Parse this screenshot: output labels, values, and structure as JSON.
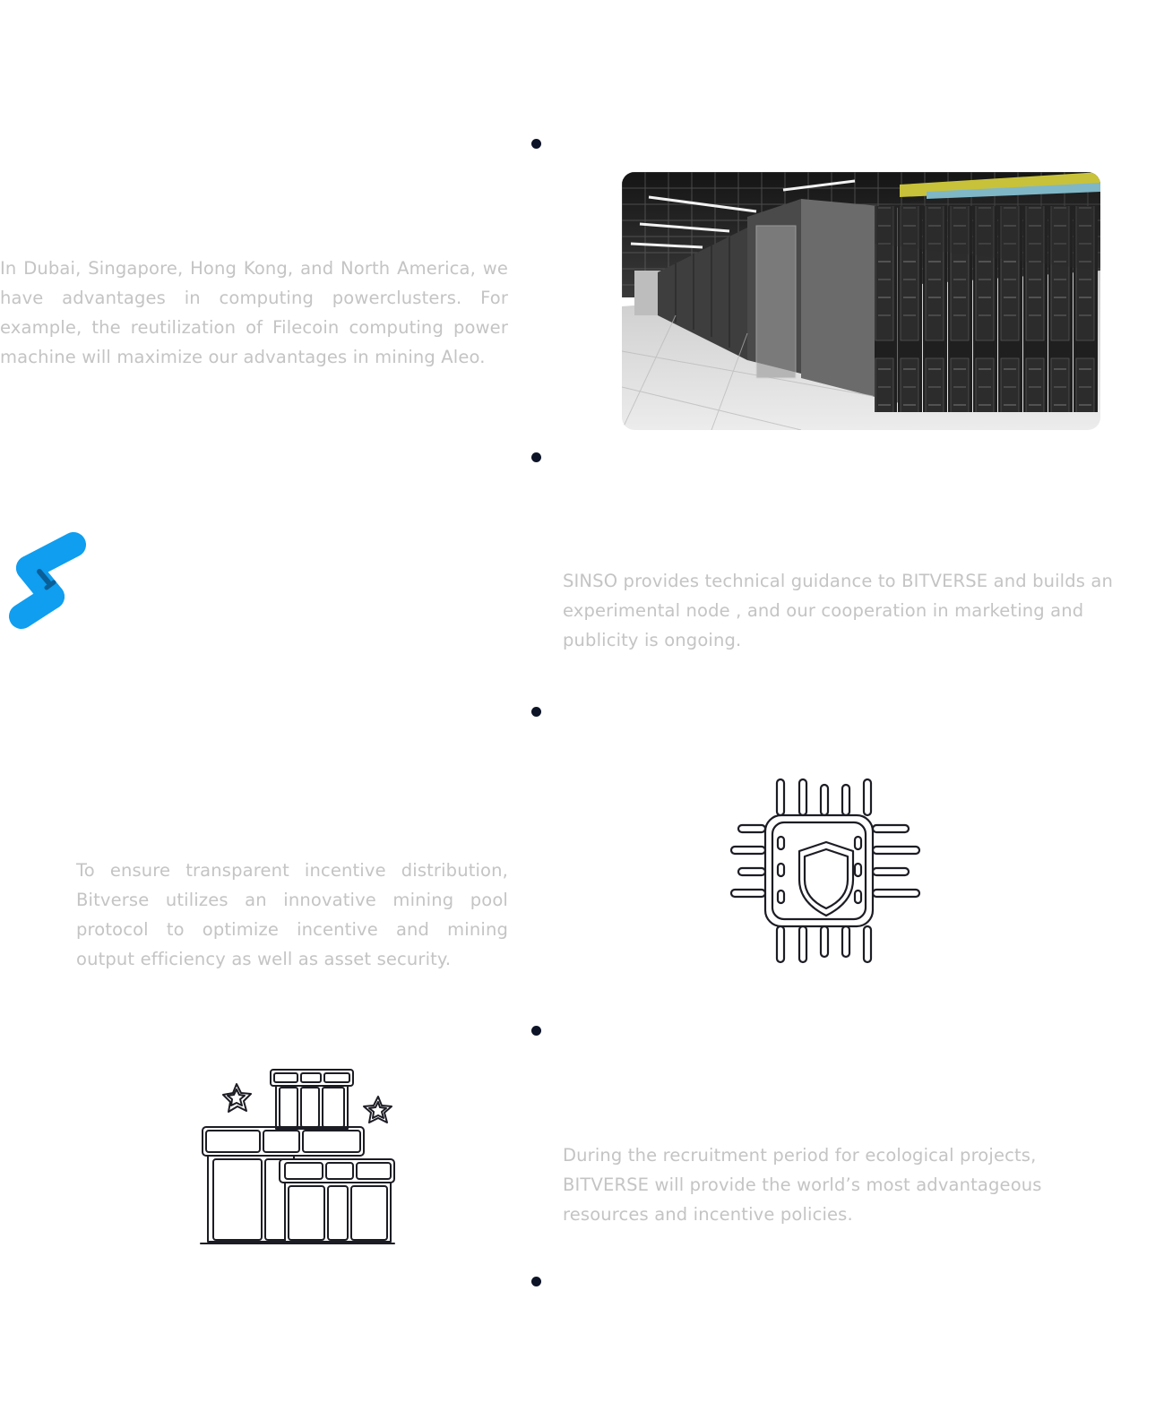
{
  "section_1": {
    "text": "In Dubai, Singapore, Hong Kong, and North America, we have advantages in computing powerclusters. For example, the reutilization of Filecoin computing power machine will maximize our advantages in mining Aleo.",
    "image": "server-room-photo"
  },
  "section_2": {
    "logo": "sinso-logo",
    "text": "SINSO provides technical guidance to BITVERSE and builds an experimental node , and our cooperation in marketing and publicity is ongoing."
  },
  "section_3": {
    "text": "To ensure transparent incentive distribution, Bitverse utilizes an innovative mining pool protocol to optimize incentive and mining output efficiency as well as asset security.",
    "icon": "chip-shield-icon"
  },
  "section_4": {
    "icon": "gift-boxes-icon",
    "text": "During the recruitment period for ecological projects, BITVERSE will provide the world’s most advantageous resources and incentive policies."
  },
  "colors": {
    "text": "#c4c4c4",
    "dot": "#0d1428",
    "logo_blue": "#0f9ef0",
    "logo_dark": "#0a5f98",
    "icon_stroke": "#1c1c24"
  }
}
